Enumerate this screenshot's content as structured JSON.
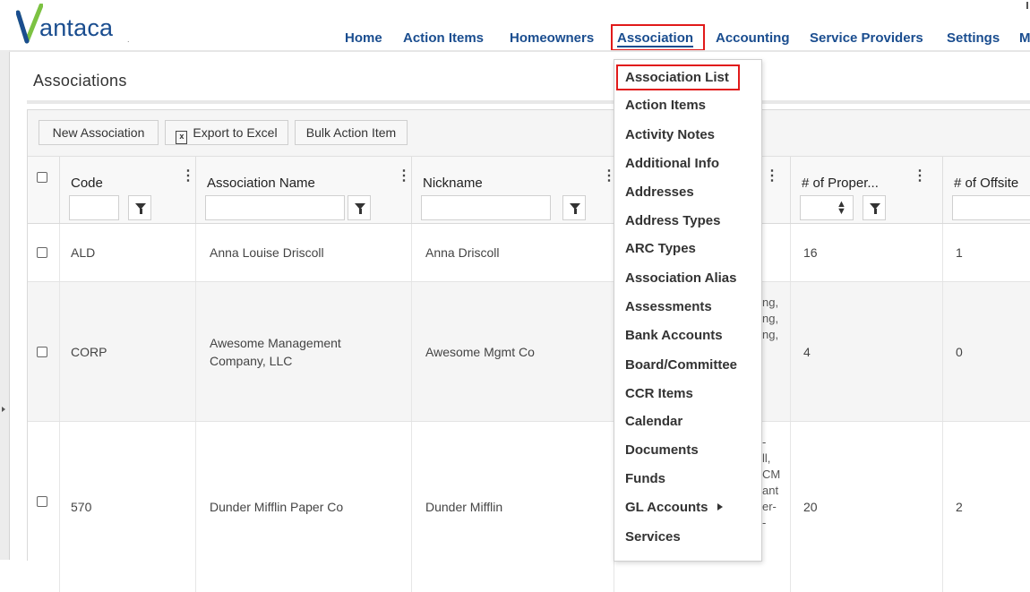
{
  "app": {
    "logo_text": "antaca",
    "logo_dot": "."
  },
  "nav": {
    "items": [
      {
        "label": "Home"
      },
      {
        "label": "Action Items"
      },
      {
        "label": "Homeowners"
      },
      {
        "label": "Association"
      },
      {
        "label": "Accounting"
      },
      {
        "label": "Service Providers"
      },
      {
        "label": "Settings"
      },
      {
        "label": "M"
      }
    ]
  },
  "page": {
    "title": "Associations"
  },
  "toolbar": {
    "new_label": "New Association",
    "export_label": "Export to Excel",
    "bulk_label": "Bulk Action Item"
  },
  "columns": {
    "code": "Code",
    "name": "Association Name",
    "nickname": "Nickname",
    "properties": "# of Proper...",
    "offsite": "# of Offsite"
  },
  "rows": [
    {
      "code": "ALD",
      "name": "Anna Louise Driscoll",
      "nickname": "Anna Driscoll",
      "partial": "",
      "properties": "16",
      "offsite": "1"
    },
    {
      "code": "CORP",
      "name": "Awesome Management\nCompany, LLC",
      "nickname": "Awesome Mgmt Co",
      "partial": "ng,\nng,\nng,",
      "properties": "4",
      "offsite": "0"
    },
    {
      "code": "570",
      "name": "Dunder Mifflin Paper Co",
      "nickname": "Dunder Mifflin",
      "partial": "-\nll,\nСM\nant\ner-\n-",
      "properties": "20",
      "offsite": "2"
    }
  ],
  "dropdown": {
    "items": [
      {
        "label": "Association List"
      },
      {
        "label": "Action Items"
      },
      {
        "label": "Activity Notes"
      },
      {
        "label": "Additional Info"
      },
      {
        "label": "Addresses"
      },
      {
        "label": "Address Types"
      },
      {
        "label": "ARC Types"
      },
      {
        "label": "Association Alias"
      },
      {
        "label": "Assessments"
      },
      {
        "label": "Bank Accounts"
      },
      {
        "label": "Board/Committee"
      },
      {
        "label": "CCR Items"
      },
      {
        "label": "Calendar"
      },
      {
        "label": "Documents"
      },
      {
        "label": "Funds"
      },
      {
        "label": "GL Accounts"
      },
      {
        "label": "Services"
      }
    ]
  },
  "colors": {
    "brand": "#1a4d8f",
    "highlight": "#e11a1a",
    "logo_green": "#7cc242"
  },
  "icons": [
    "funnel-icon",
    "kebab-icon",
    "excel-icon",
    "sort-icon",
    "submenu-arrow-icon"
  ]
}
